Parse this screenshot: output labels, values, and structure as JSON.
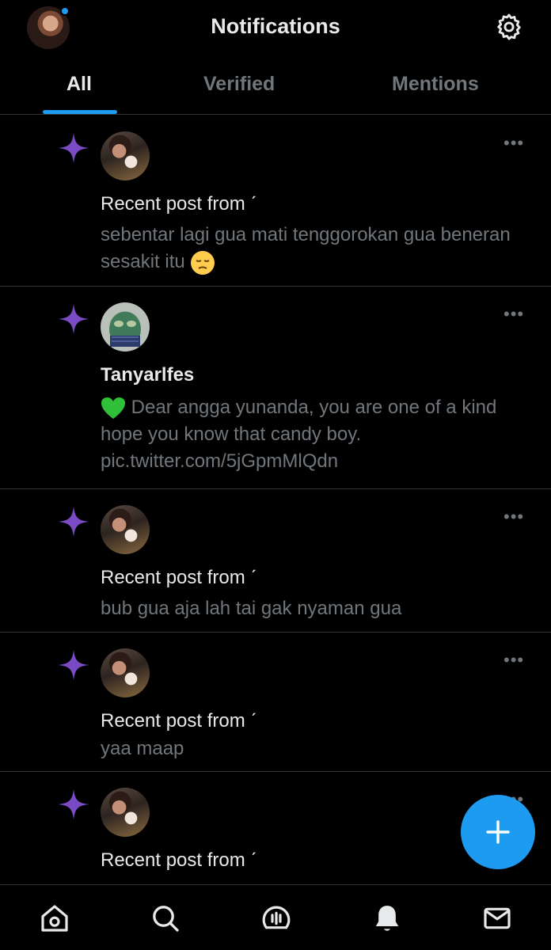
{
  "header": {
    "title": "Notifications",
    "tabs": [
      {
        "label": "All",
        "active": true
      },
      {
        "label": "Verified",
        "active": false
      },
      {
        "label": "Mentions",
        "active": false
      }
    ]
  },
  "notifications": [
    {
      "title": "Recent post from ˊ",
      "body": "sebentar lagi gua mati tenggorokan gua beneran sesakit itu",
      "emoji": "pensive-face"
    },
    {
      "title": "Tanyarlfes",
      "emoji": "green-heart",
      "body": "Dear angga yunanda, you are one of a kind hope you know that candy boy.",
      "link": "pic.twitter.com/5jGpmMlQdn"
    },
    {
      "title": "Recent post from ˊ",
      "body": "bub gua aja lah tai gak nyaman gua"
    },
    {
      "title": "Recent post from ˊ",
      "body": "yaa maap"
    },
    {
      "title": "Recent post from ˊ",
      "body": ""
    }
  ],
  "more_label": "•••",
  "fab_label": "+",
  "colors": {
    "accent": "#1d9bf0",
    "sparkle": "#794bc4",
    "background": "#000000",
    "muted": "#71767b",
    "text": "#e7e9ea"
  },
  "bottom_nav": [
    "home-icon",
    "search-icon",
    "spaces-icon",
    "notifications-icon",
    "messages-icon"
  ]
}
